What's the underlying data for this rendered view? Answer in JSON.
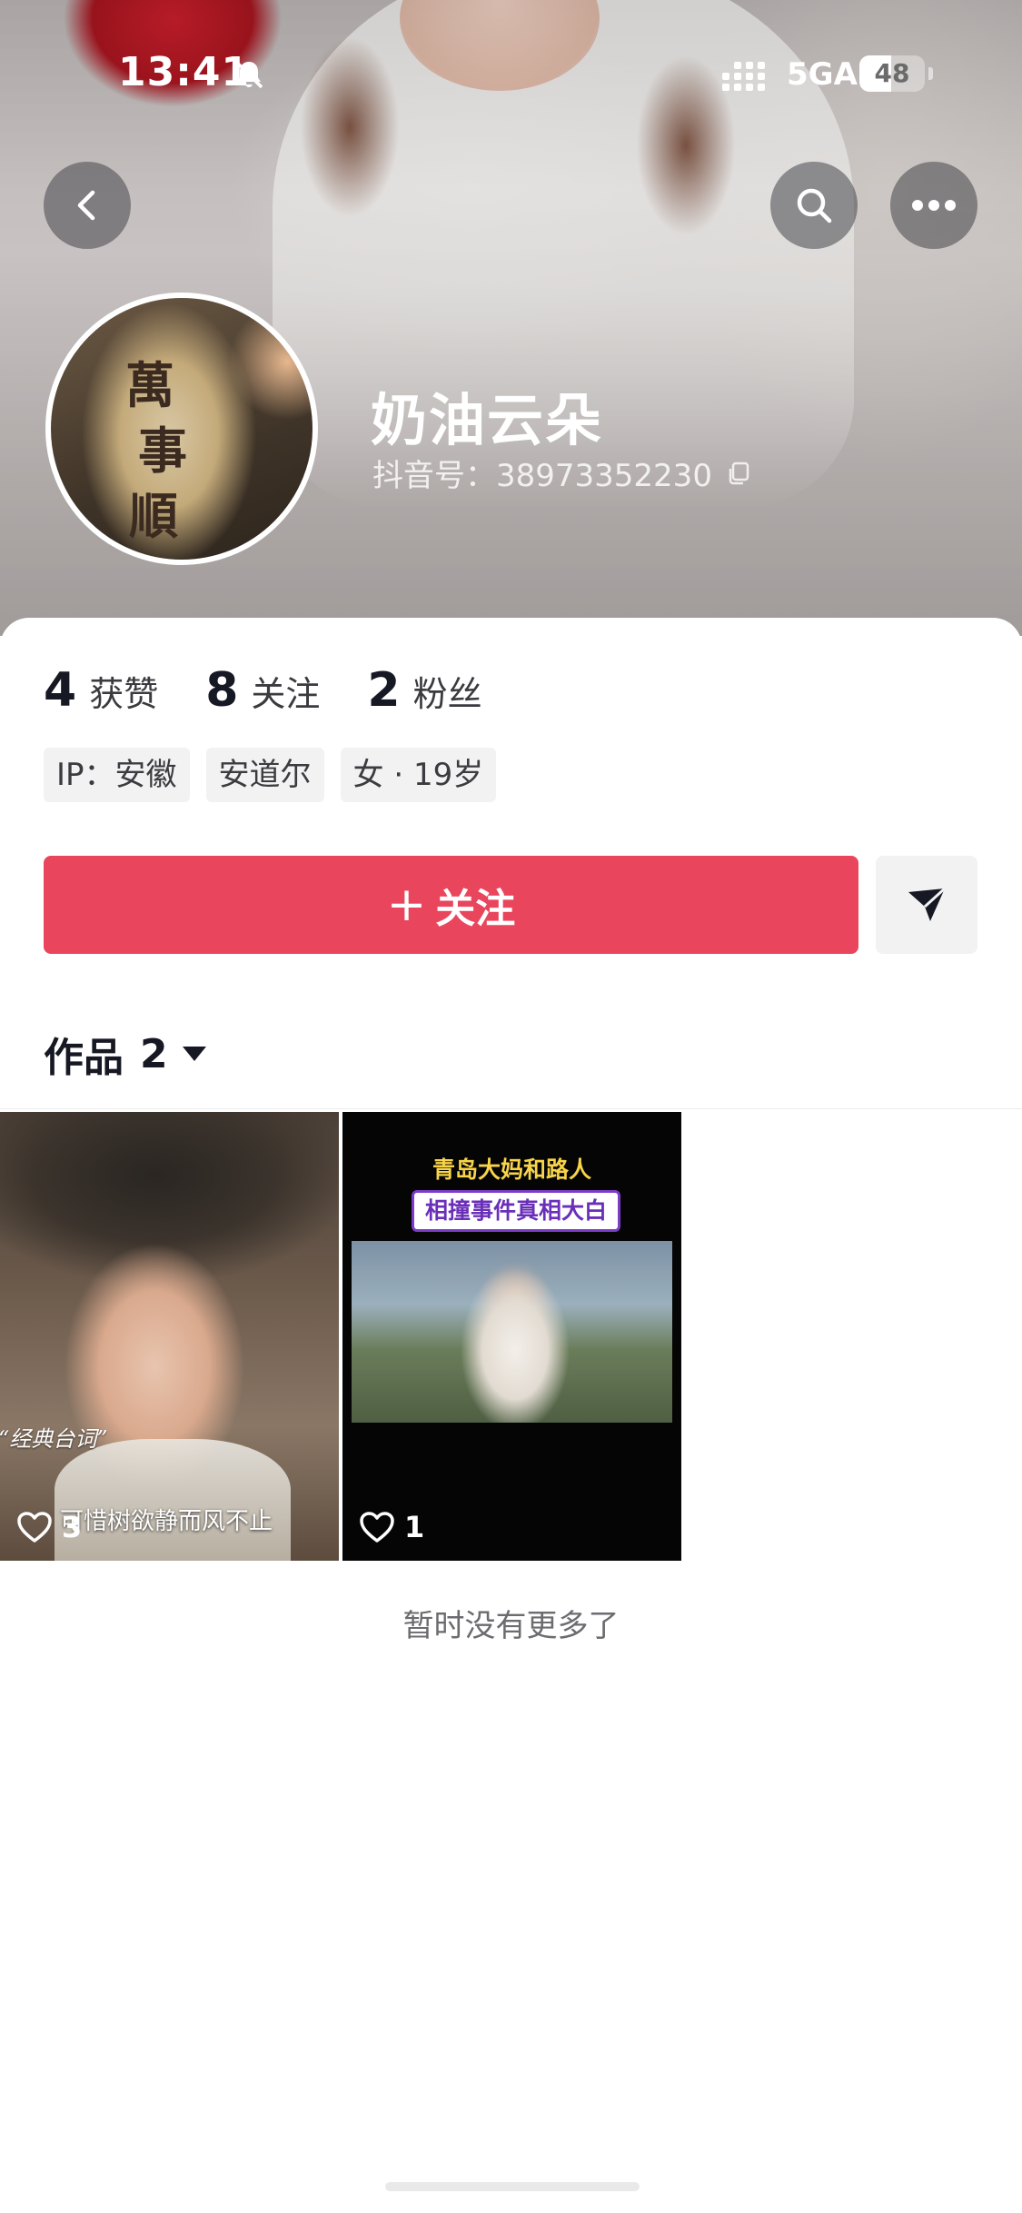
{
  "status_bar": {
    "time": "13:41",
    "network": "5GA",
    "battery": "48",
    "battery_level_percent": 48
  },
  "profile": {
    "nickname": "奶油云朵",
    "douyin_id": "抖音号：38973352230",
    "stats": [
      {
        "value": "4",
        "label": "获赞"
      },
      {
        "value": "8",
        "label": "关注"
      },
      {
        "value": "2",
        "label": "粉丝"
      }
    ],
    "tags": [
      "IP：安徽",
      "安道尔",
      "女 · 19岁"
    ],
    "avatar_text": "萬事順"
  },
  "actions": {
    "follow_label": "关注",
    "follow_plus": "+"
  },
  "works": {
    "tab_label": "作品",
    "count": "2",
    "items": [
      {
        "likes": "3",
        "caption_top": "“经典台词”",
        "caption_bottom": "可惜树欲静而风不止"
      },
      {
        "likes": "1",
        "title_line1": "青岛大妈和路人",
        "title_line2": "相撞事件真相大白"
      }
    ],
    "empty_text": "暂时没有更多了"
  },
  "colors": {
    "accent": "#e9455c",
    "tag_bg": "#f2f2f3"
  }
}
